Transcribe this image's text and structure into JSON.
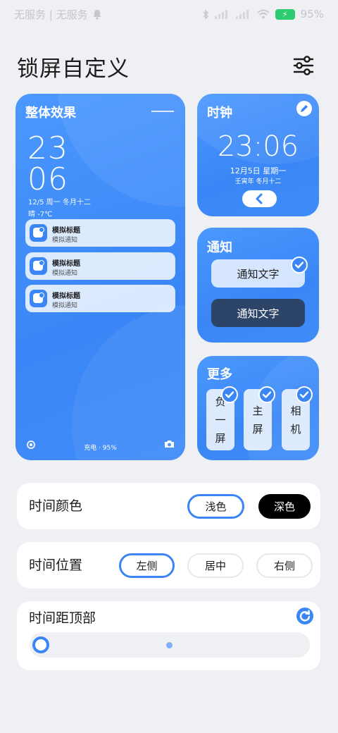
{
  "status_bar": {
    "left_text": "无服务 | 无服务",
    "battery_percent": "95%",
    "icons": [
      "bell-icon",
      "bluetooth-icon",
      "signal-icon",
      "wifi-icon",
      "battery-icon"
    ]
  },
  "header": {
    "title": "锁屏自定义",
    "settings_icon": "sliders-icon"
  },
  "preview": {
    "title": "整体效果",
    "hour": "23",
    "minute": "06",
    "date_line": "12/5 周一  冬月十二",
    "weather": "晴 -7℃",
    "notifications": [
      {
        "title": "模拟标题",
        "body": "模拟通知"
      },
      {
        "title": "模拟标题",
        "body": "模拟通知"
      },
      {
        "title": "模拟标题",
        "body": "模拟通知"
      }
    ],
    "charging": "充电 · 95%",
    "bottom_icons": [
      "fingerprint-icon",
      "camera-icon"
    ]
  },
  "clock_card": {
    "title": "时钟",
    "time": "23:06",
    "date": "12月5日 星期一",
    "lunar": "壬寅年 冬月十二",
    "edit_icon": "pencil-icon",
    "back_icon": "chevron-left-icon"
  },
  "notify_card": {
    "title": "通知",
    "options": [
      {
        "label": "通知文字",
        "style": "light",
        "checked": true
      },
      {
        "label": "通知文字",
        "style": "dark",
        "checked": false
      }
    ]
  },
  "more_card": {
    "title": "更多",
    "items": [
      {
        "chars": [
          "负",
          "一",
          "屏"
        ],
        "checked": true
      },
      {
        "chars": [
          "主",
          "屏"
        ],
        "checked": true
      },
      {
        "chars": [
          "相",
          "机"
        ],
        "checked": true
      }
    ]
  },
  "time_color": {
    "label": "时间颜色",
    "options": [
      "浅色",
      "深色"
    ],
    "selected": "浅色"
  },
  "time_position": {
    "label": "时间位置",
    "options": [
      "左侧",
      "居中",
      "右侧"
    ],
    "selected": "左侧"
  },
  "time_top": {
    "label": "时间距顶部",
    "reset_icon": "refresh-icon",
    "slider_value": 0
  },
  "colors": {
    "accent": "#3a86f6",
    "card_blue": "#4b98ff",
    "dark_notify": "#2d4469"
  }
}
